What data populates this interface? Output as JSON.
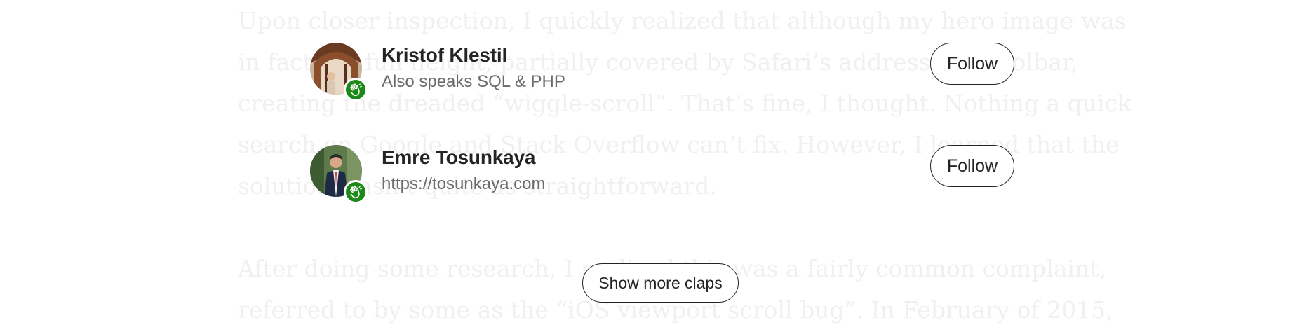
{
  "article": {
    "paragraph1_lines": [
      "Upon closer inspection, I quickly realized that although my hero image was",
      "in fact the full height, partially covered by Safari’s address and toolbar,",
      "creating the dreaded “wiggle-scroll”. That’s fine, I thought. Nothing a quick",
      "search on Google and Stack Overflow can’t fix. However, I learned that the",
      "solution wasn’t quite as straightforward."
    ],
    "paragraph2_lines": [
      "After doing some research, I realized this was a fairly common complaint,",
      "referred to by some as the “iOS viewport scroll bug”. In February of 2015,"
    ]
  },
  "clappers": [
    {
      "name": "Kristof Klestil",
      "bio": "Also speaks SQL & PHP",
      "follow_label": "Follow",
      "badge_icon": "clap-hand-icon"
    },
    {
      "name": "Emre Tosunkaya",
      "bio": "https://tosunkaya.com",
      "follow_label": "Follow",
      "badge_icon": "clap-hand-icon"
    }
  ],
  "show_more_label": "Show more claps",
  "colors": {
    "badge_green": "#1a8917",
    "text_primary": "#242424",
    "text_secondary": "#6b6b6b"
  }
}
